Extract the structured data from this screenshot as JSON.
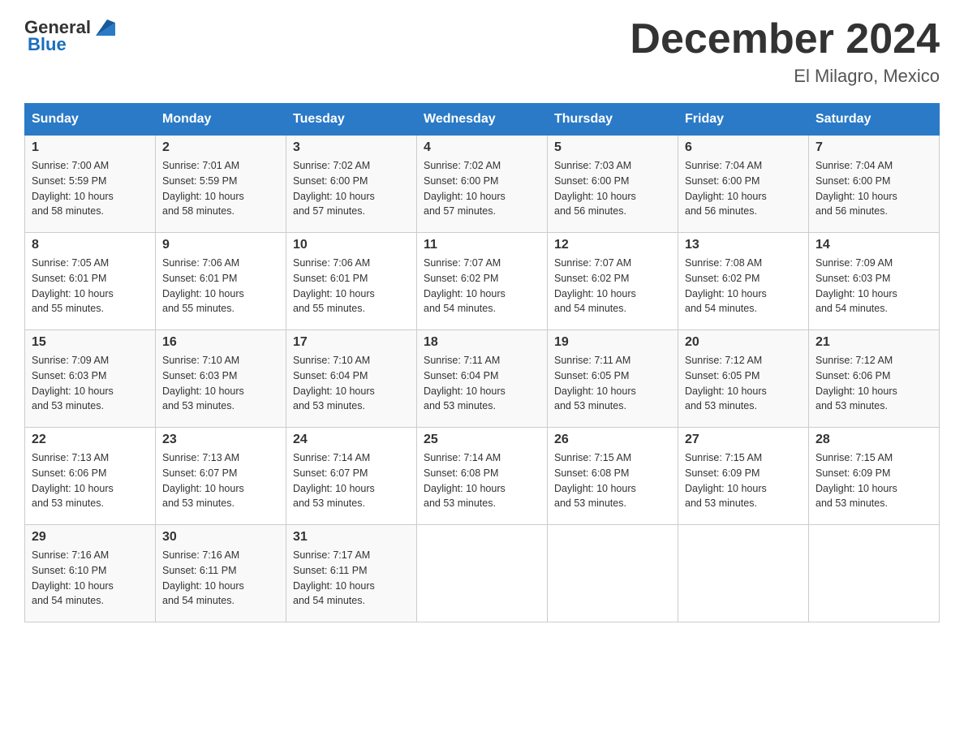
{
  "header": {
    "logo_general": "General",
    "logo_blue": "Blue",
    "title": "December 2024",
    "subtitle": "El Milagro, Mexico"
  },
  "days_of_week": [
    "Sunday",
    "Monday",
    "Tuesday",
    "Wednesday",
    "Thursday",
    "Friday",
    "Saturday"
  ],
  "weeks": [
    [
      {
        "day": "1",
        "sunrise": "7:00 AM",
        "sunset": "5:59 PM",
        "daylight": "10 hours and 58 minutes."
      },
      {
        "day": "2",
        "sunrise": "7:01 AM",
        "sunset": "5:59 PM",
        "daylight": "10 hours and 58 minutes."
      },
      {
        "day": "3",
        "sunrise": "7:02 AM",
        "sunset": "6:00 PM",
        "daylight": "10 hours and 57 minutes."
      },
      {
        "day": "4",
        "sunrise": "7:02 AM",
        "sunset": "6:00 PM",
        "daylight": "10 hours and 57 minutes."
      },
      {
        "day": "5",
        "sunrise": "7:03 AM",
        "sunset": "6:00 PM",
        "daylight": "10 hours and 56 minutes."
      },
      {
        "day": "6",
        "sunrise": "7:04 AM",
        "sunset": "6:00 PM",
        "daylight": "10 hours and 56 minutes."
      },
      {
        "day": "7",
        "sunrise": "7:04 AM",
        "sunset": "6:00 PM",
        "daylight": "10 hours and 56 minutes."
      }
    ],
    [
      {
        "day": "8",
        "sunrise": "7:05 AM",
        "sunset": "6:01 PM",
        "daylight": "10 hours and 55 minutes."
      },
      {
        "day": "9",
        "sunrise": "7:06 AM",
        "sunset": "6:01 PM",
        "daylight": "10 hours and 55 minutes."
      },
      {
        "day": "10",
        "sunrise": "7:06 AM",
        "sunset": "6:01 PM",
        "daylight": "10 hours and 55 minutes."
      },
      {
        "day": "11",
        "sunrise": "7:07 AM",
        "sunset": "6:02 PM",
        "daylight": "10 hours and 54 minutes."
      },
      {
        "day": "12",
        "sunrise": "7:07 AM",
        "sunset": "6:02 PM",
        "daylight": "10 hours and 54 minutes."
      },
      {
        "day": "13",
        "sunrise": "7:08 AM",
        "sunset": "6:02 PM",
        "daylight": "10 hours and 54 minutes."
      },
      {
        "day": "14",
        "sunrise": "7:09 AM",
        "sunset": "6:03 PM",
        "daylight": "10 hours and 54 minutes."
      }
    ],
    [
      {
        "day": "15",
        "sunrise": "7:09 AM",
        "sunset": "6:03 PM",
        "daylight": "10 hours and 53 minutes."
      },
      {
        "day": "16",
        "sunrise": "7:10 AM",
        "sunset": "6:03 PM",
        "daylight": "10 hours and 53 minutes."
      },
      {
        "day": "17",
        "sunrise": "7:10 AM",
        "sunset": "6:04 PM",
        "daylight": "10 hours and 53 minutes."
      },
      {
        "day": "18",
        "sunrise": "7:11 AM",
        "sunset": "6:04 PM",
        "daylight": "10 hours and 53 minutes."
      },
      {
        "day": "19",
        "sunrise": "7:11 AM",
        "sunset": "6:05 PM",
        "daylight": "10 hours and 53 minutes."
      },
      {
        "day": "20",
        "sunrise": "7:12 AM",
        "sunset": "6:05 PM",
        "daylight": "10 hours and 53 minutes."
      },
      {
        "day": "21",
        "sunrise": "7:12 AM",
        "sunset": "6:06 PM",
        "daylight": "10 hours and 53 minutes."
      }
    ],
    [
      {
        "day": "22",
        "sunrise": "7:13 AM",
        "sunset": "6:06 PM",
        "daylight": "10 hours and 53 minutes."
      },
      {
        "day": "23",
        "sunrise": "7:13 AM",
        "sunset": "6:07 PM",
        "daylight": "10 hours and 53 minutes."
      },
      {
        "day": "24",
        "sunrise": "7:14 AM",
        "sunset": "6:07 PM",
        "daylight": "10 hours and 53 minutes."
      },
      {
        "day": "25",
        "sunrise": "7:14 AM",
        "sunset": "6:08 PM",
        "daylight": "10 hours and 53 minutes."
      },
      {
        "day": "26",
        "sunrise": "7:15 AM",
        "sunset": "6:08 PM",
        "daylight": "10 hours and 53 minutes."
      },
      {
        "day": "27",
        "sunrise": "7:15 AM",
        "sunset": "6:09 PM",
        "daylight": "10 hours and 53 minutes."
      },
      {
        "day": "28",
        "sunrise": "7:15 AM",
        "sunset": "6:09 PM",
        "daylight": "10 hours and 53 minutes."
      }
    ],
    [
      {
        "day": "29",
        "sunrise": "7:16 AM",
        "sunset": "6:10 PM",
        "daylight": "10 hours and 54 minutes."
      },
      {
        "day": "30",
        "sunrise": "7:16 AM",
        "sunset": "6:11 PM",
        "daylight": "10 hours and 54 minutes."
      },
      {
        "day": "31",
        "sunrise": "7:17 AM",
        "sunset": "6:11 PM",
        "daylight": "10 hours and 54 minutes."
      },
      null,
      null,
      null,
      null
    ]
  ],
  "labels": {
    "sunrise": "Sunrise:",
    "sunset": "Sunset:",
    "daylight": "Daylight:"
  }
}
